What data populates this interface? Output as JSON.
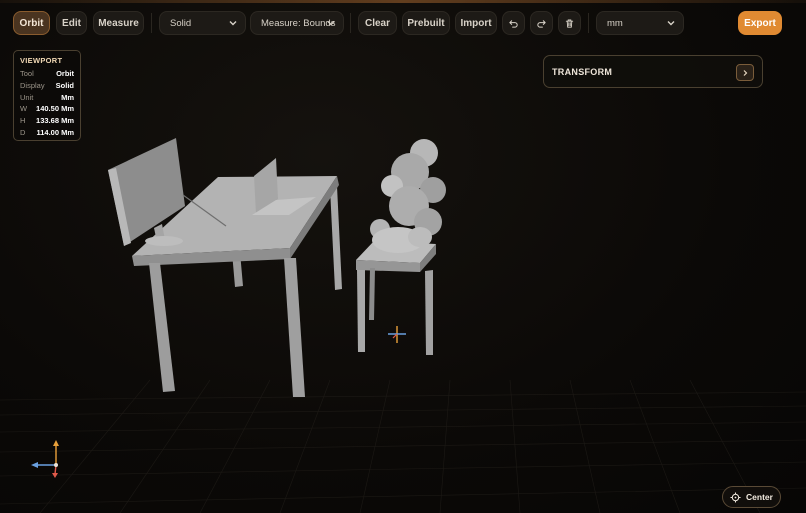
{
  "toolbar": {
    "modes": [
      "Orbit",
      "Edit",
      "Measure"
    ],
    "active_mode": "Orbit",
    "display_select": "Solid",
    "measure_select": "Measure: Bounds",
    "actions": [
      "Clear",
      "Prebuilt",
      "Import"
    ],
    "unit_select": "mm",
    "export_label": "Export",
    "icons": [
      "undo-icon",
      "redo-icon",
      "trash-icon"
    ],
    "accent_color": "#e08a32"
  },
  "viewport_info": {
    "title": "VIEWPORT",
    "rows": [
      {
        "key": "Tool",
        "value": "Orbit"
      },
      {
        "key": "Display",
        "value": "Solid"
      },
      {
        "key": "Unit",
        "value": "Mm"
      },
      {
        "key": "W",
        "value": "140.50 Mm"
      },
      {
        "key": "H",
        "value": "133.68 Mm"
      },
      {
        "key": "D",
        "value": "114.00 Mm"
      }
    ]
  },
  "transform_panel": {
    "title": "TRANSFORM",
    "expand_icon": "chevron-right-icon"
  },
  "center_button": {
    "label": "Center",
    "icon": "crosshair-icon"
  }
}
